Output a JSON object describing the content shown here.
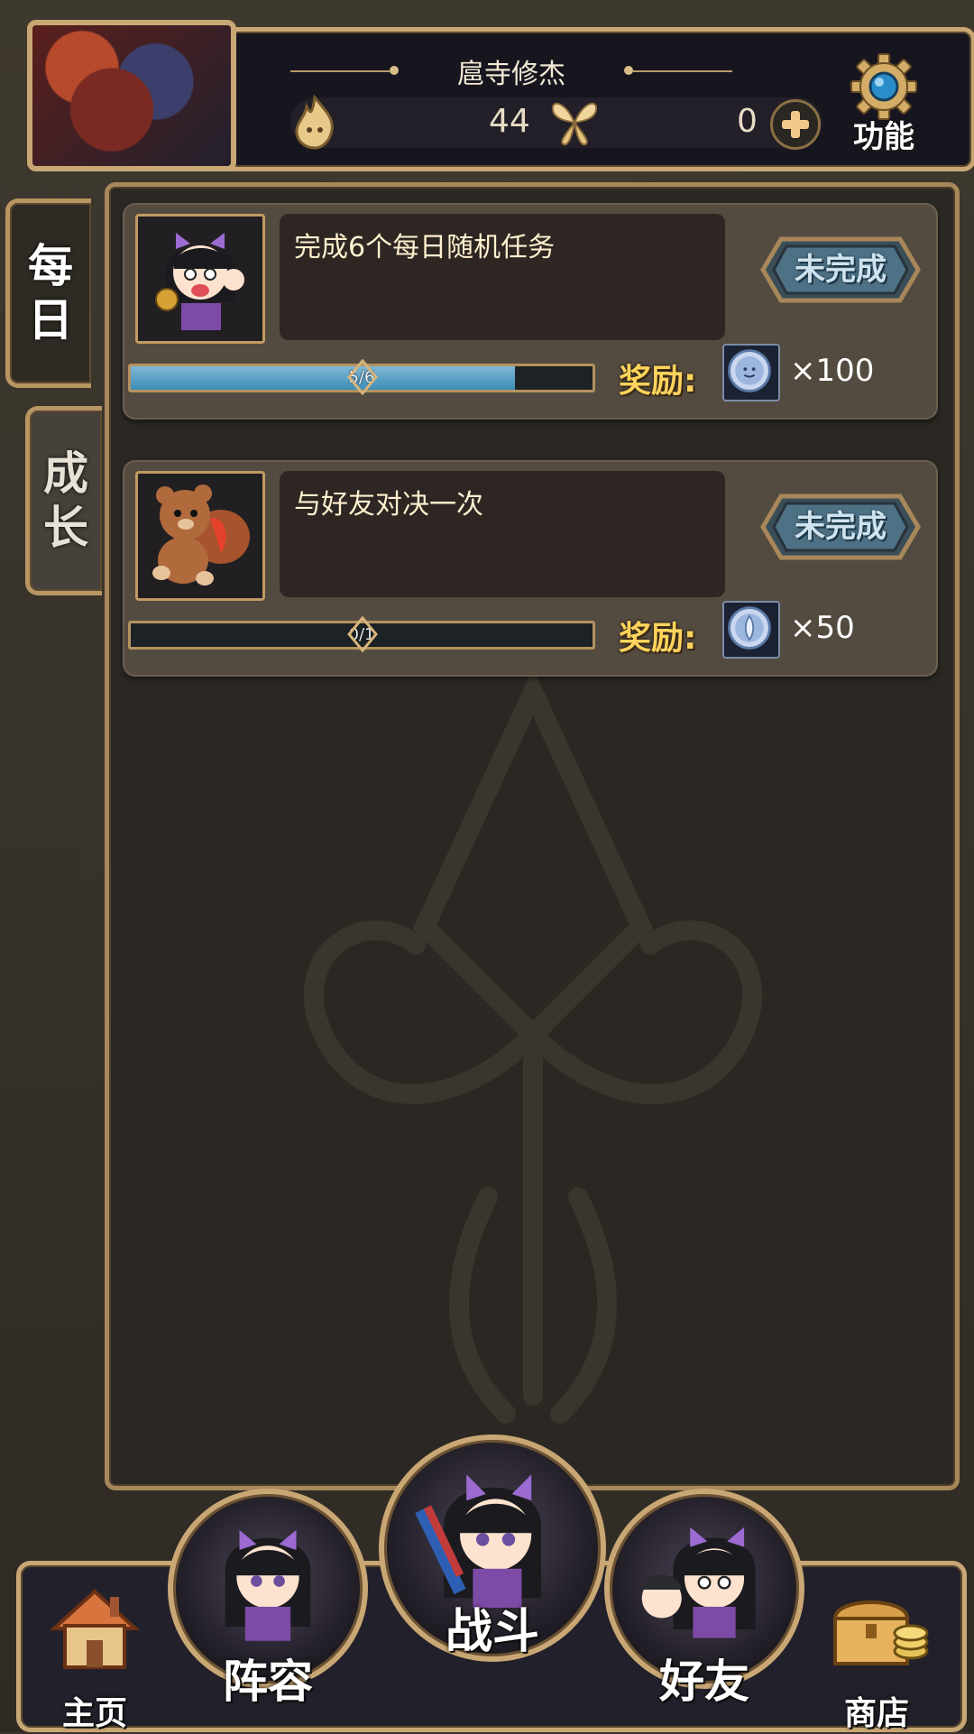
{
  "header": {
    "player_name": "扈寺修杰",
    "stamina": "44",
    "gems": "0",
    "function_label": "功能"
  },
  "tabs": [
    {
      "label_chars": [
        "每",
        "日"
      ]
    },
    {
      "label_chars": [
        "成",
        "长"
      ]
    }
  ],
  "quests": [
    {
      "description": "完成6个每日随机任务",
      "status": "未完成",
      "progress_text": "5/6",
      "progress": 0.833,
      "reward_label": "奖励:",
      "reward_qty": "×100"
    },
    {
      "description": "与好友对决一次",
      "status": "未完成",
      "progress_text": "0/1",
      "progress": 0,
      "reward_label": "奖励:",
      "reward_qty": "×50"
    }
  ],
  "nav": {
    "home": "主页",
    "team": "阵容",
    "battle": "战斗",
    "friends": "好友",
    "shop": "商店"
  },
  "colors": {
    "gold_frame": "#c9a774",
    "reward_text": "#ffd35c",
    "progress_fill": "#3b8db6"
  },
  "icons": {
    "stamina": "flame-icon",
    "currency": "butterfly-icon",
    "add": "plus-icon",
    "settings": "gear-icon",
    "reward": "coin-icon",
    "home": "house-icon",
    "shop": "chest-icon"
  }
}
